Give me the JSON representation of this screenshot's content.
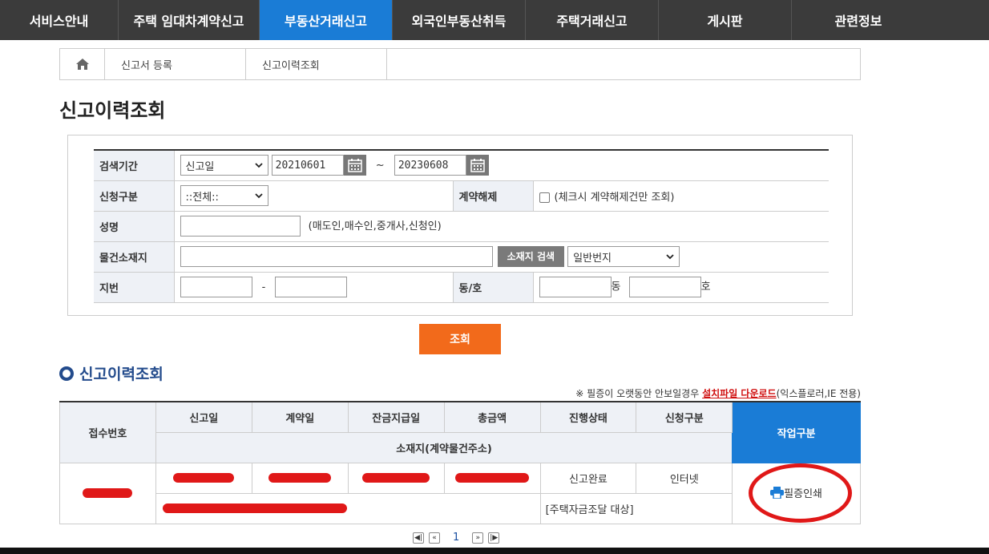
{
  "nav": {
    "items": [
      {
        "label": "서비스안내"
      },
      {
        "label": "주택 임대차계약신고"
      },
      {
        "label": "부동산거래신고"
      },
      {
        "label": "외국인부동산취득"
      },
      {
        "label": "주택거래신고"
      },
      {
        "label": "게시판"
      },
      {
        "label": "관련정보"
      }
    ],
    "active_index": 2,
    "colors": {
      "bar": "#3b3b3b",
      "active": "#1a7cd6"
    }
  },
  "breadcrumb": {
    "home_icon": "home-icon",
    "items": [
      "신고서 등록",
      "신고이력조회"
    ]
  },
  "page_title": "신고이력조회",
  "search_form": {
    "period_label": "검색기간",
    "period_type": "신고일",
    "date_from": "20210601",
    "date_sep": "~",
    "date_to": "20230608",
    "apply_type_label": "신청구분",
    "apply_type_value": "::전체::",
    "cancel_label": "계약해제",
    "cancel_checkbox_text": "(체크시 계약해제건만 조회)",
    "name_label": "성명",
    "name_value": "",
    "name_hint": "(매도인,매수인,중개사,신청인)",
    "location_label": "물건소재지",
    "location_value": "",
    "location_search_button": "소재지 검색",
    "lot_type_value": "일반번지",
    "lot_label": "지번",
    "lot_sep": "-",
    "dongho_label": "동/호",
    "dong_suffix": "동",
    "ho_suffix": "호",
    "submit_label": "조회"
  },
  "results": {
    "section_title": "신고이력조회",
    "notice_prefix": "※ 필증이 오랫동안 안보일경우",
    "notice_link": "설치파일 다운로드",
    "notice_suffix": "(익스플로러,IE 전용)",
    "headers": {
      "receipt_no": "접수번호",
      "report_date": "신고일",
      "contract_date": "계약일",
      "balance_date": "잔금지급일",
      "total_amount": "총금액",
      "status": "진행상태",
      "apply_type": "신청구분",
      "address": "소재지(계약물건주소)",
      "work": "작업구분"
    },
    "rows": [
      {
        "status": "신고완료",
        "apply_type": "인터넷",
        "note": "[주택자금조달 대상]",
        "action": "필증인쇄",
        "action_icon": "printer-icon"
      }
    ]
  },
  "pagination": {
    "current_page": "1",
    "first_icon": "first-page-icon",
    "prev_icon": "prev-page-icon",
    "next_icon": "next-page-icon",
    "last_icon": "last-page-icon"
  }
}
